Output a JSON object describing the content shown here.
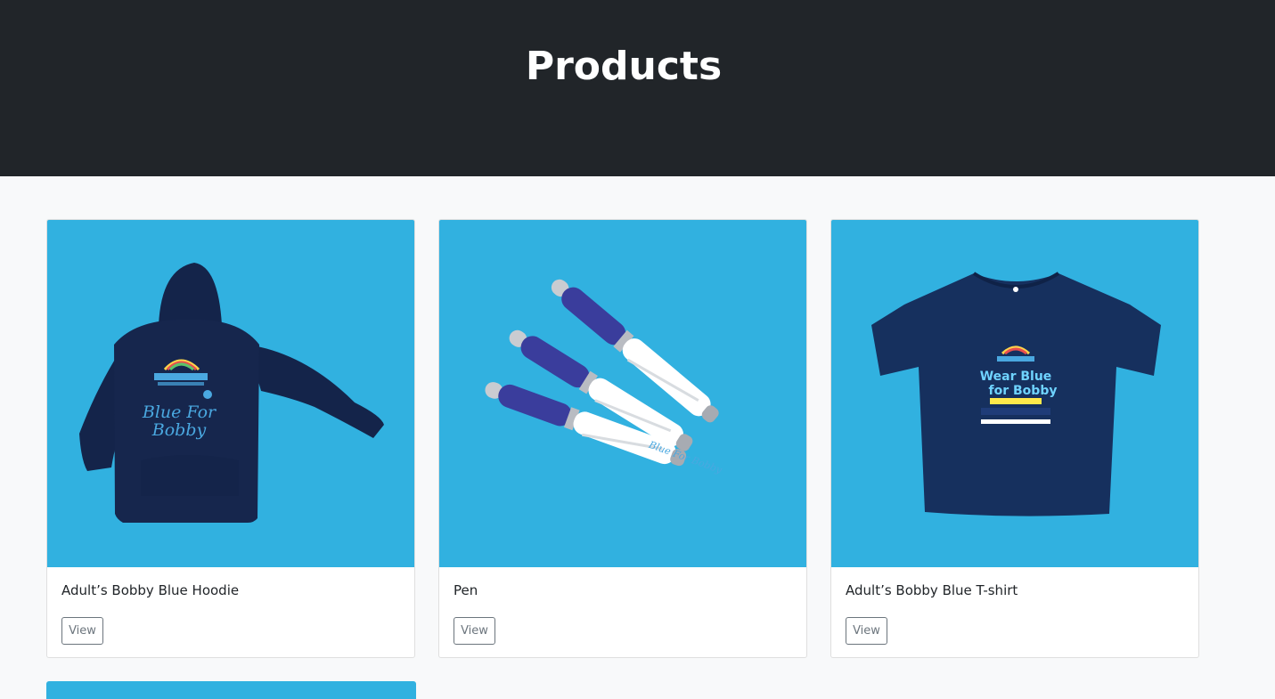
{
  "header": {
    "title": "Products"
  },
  "products": [
    {
      "title": "Adult’s Bobby Blue Hoodie",
      "button_label": "View",
      "image_icon": "hoodie-image",
      "print_line": "Blue For",
      "print_line2": "Bobby"
    },
    {
      "title": "Pen",
      "button_label": "View",
      "image_icon": "pens-image",
      "print_line": "Blue For Bobby"
    },
    {
      "title": "Adult’s Bobby Blue T-shirt",
      "button_label": "View",
      "image_icon": "tshirt-image",
      "print_line": "Wear Blue",
      "print_line2": "for Bobby"
    }
  ],
  "colors": {
    "header_bg": "#212529",
    "page_bg": "#f8f9fa",
    "image_bg": "#31b1e0",
    "garment_navy": "#16264d",
    "pen_grip": "#3a3d9c",
    "print_blue": "#4aa8e0"
  }
}
